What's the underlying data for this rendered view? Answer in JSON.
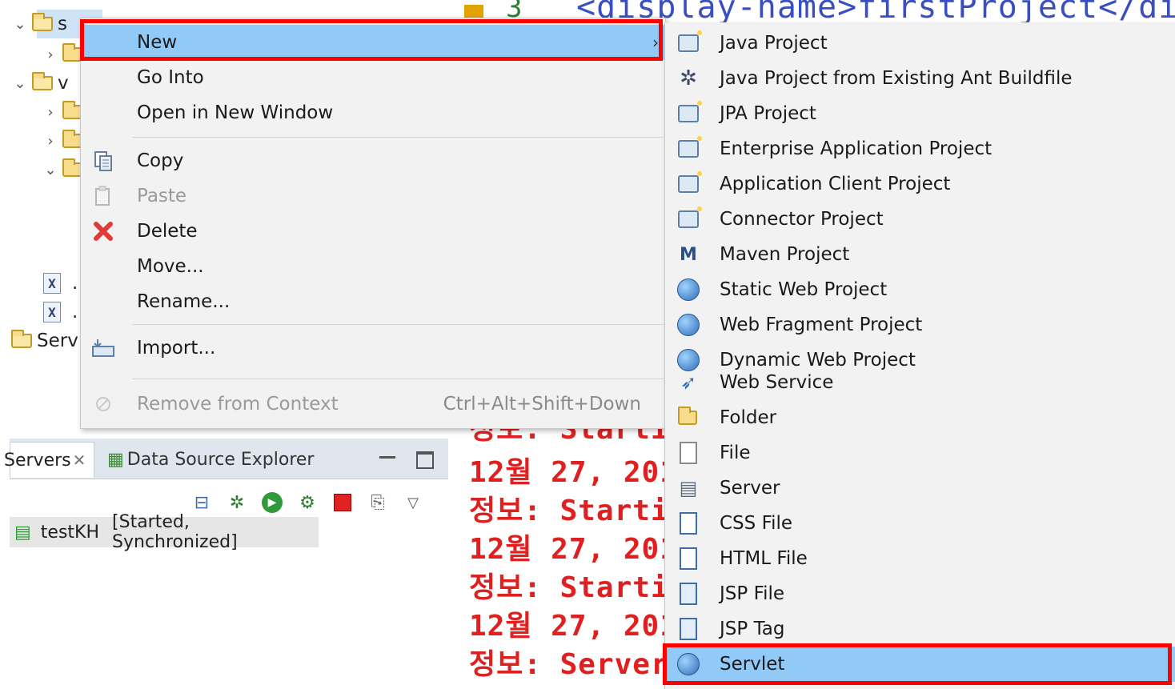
{
  "tree": {
    "rows": [
      {
        "label": "s"
      },
      {
        "label": ""
      },
      {
        "label": "v"
      },
      {
        "label": ""
      },
      {
        "label": ""
      },
      {
        "label": ""
      },
      {
        "label": "."
      },
      {
        "label": "."
      },
      {
        "label": "Serv"
      }
    ]
  },
  "editor": {
    "code_text": "<display-name>firstProject</dis",
    "gutter_char": "3"
  },
  "console": {
    "lines": [
      "정보: Starti",
      "12월 27, 201",
      "정보: Starti",
      "12월 27, 201",
      "정보: Starti",
      "12월 27, 201",
      "정보: Server"
    ]
  },
  "servers_view": {
    "tabs": [
      {
        "label": "Servers"
      },
      {
        "label": "Data Source Explorer"
      }
    ],
    "server_name": "testKH",
    "server_status": "[Started, Synchronized]"
  },
  "context_menu": {
    "items": [
      {
        "label": "New",
        "arrow": "›",
        "icon": ""
      },
      {
        "label": "Go Into",
        "icon": ""
      },
      {
        "label": "Open in New Window",
        "icon": ""
      },
      {
        "label": "Copy",
        "icon": "copy-icon"
      },
      {
        "label": "Paste",
        "icon": "paste-icon"
      },
      {
        "label": "Delete",
        "icon": "delete-icon"
      },
      {
        "label": "Move...",
        "icon": ""
      },
      {
        "label": "Rename...",
        "icon": ""
      },
      {
        "label": "Import...",
        "icon": "import-icon"
      },
      {
        "label": "Remove from Context",
        "accelerator": "Ctrl+Alt+Shift+Down",
        "icon": "remove-context-icon"
      }
    ]
  },
  "new_submenu": {
    "items": [
      {
        "label": "Java Project"
      },
      {
        "label": "Java Project from Existing Ant Buildfile"
      },
      {
        "label": "JPA Project"
      },
      {
        "label": "Enterprise Application Project"
      },
      {
        "label": "Application Client Project"
      },
      {
        "label": "Connector Project"
      },
      {
        "label": "Maven Project"
      },
      {
        "label": "Static Web Project"
      },
      {
        "label": "Web Fragment Project"
      },
      {
        "label": "Dynamic Web Project"
      },
      {
        "label": "Web Service"
      },
      {
        "label": "Folder"
      },
      {
        "label": "File"
      },
      {
        "label": "Server"
      },
      {
        "label": "CSS File"
      },
      {
        "label": "HTML File"
      },
      {
        "label": "JSP File"
      },
      {
        "label": "JSP Tag"
      },
      {
        "label": "Servlet"
      }
    ]
  },
  "colors": {
    "highlight": "#91c9f7",
    "annotation_red": "#ff0000",
    "console_red": "#e02020"
  }
}
